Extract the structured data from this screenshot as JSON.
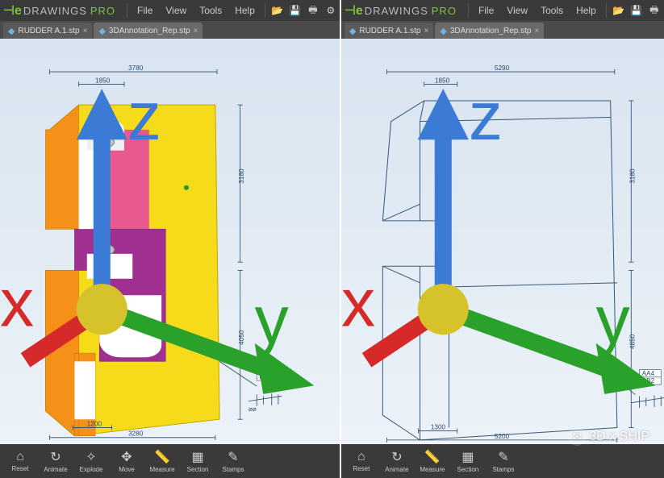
{
  "app": {
    "logo_text": "DRAWINGS",
    "logo_suffix": "PRO"
  },
  "menu": {
    "file": "File",
    "view": "View",
    "tools": "Tools",
    "help": "Help"
  },
  "tabs": [
    {
      "label": "RUDDER A.1.stp",
      "active": false
    },
    {
      "label": "3DAnnotation_Rep.stp",
      "active": true
    }
  ],
  "bottom_buttons": {
    "left": [
      {
        "label": "Reset",
        "icon": "⌂"
      },
      {
        "label": "Animate",
        "icon": "↻"
      },
      {
        "label": "Explode",
        "icon": "✧"
      },
      {
        "label": "Move",
        "icon": "✥"
      },
      {
        "label": "Measure",
        "icon": "📏"
      },
      {
        "label": "Section",
        "icon": "▦"
      },
      {
        "label": "Stamps",
        "icon": "✎"
      }
    ],
    "right": [
      {
        "label": "Reset",
        "icon": "⌂"
      },
      {
        "label": "Animate",
        "icon": "↻"
      },
      {
        "label": "Measure",
        "icon": "📏"
      },
      {
        "label": "Section",
        "icon": "▦"
      },
      {
        "label": "Stamps",
        "icon": "✎"
      }
    ]
  },
  "dimensions": {
    "top_near": "1850",
    "top_far": "3780",
    "bottom_near": "1200",
    "bottom_far": "3280",
    "right_top": "3180",
    "right_bottom": "4050"
  },
  "right_dimensions": {
    "top_near": "1850",
    "top_far": "5290",
    "bottom_near": "1300",
    "bottom_far": "5200",
    "right_top": "3180",
    "right_bottom": "4850"
  },
  "annotation_boxes": {
    "a": "AA4",
    "b": "BB2"
  },
  "triad_axes": {
    "x": "x",
    "y": "y",
    "z": "z"
  },
  "watermark": "3D x SHIP"
}
